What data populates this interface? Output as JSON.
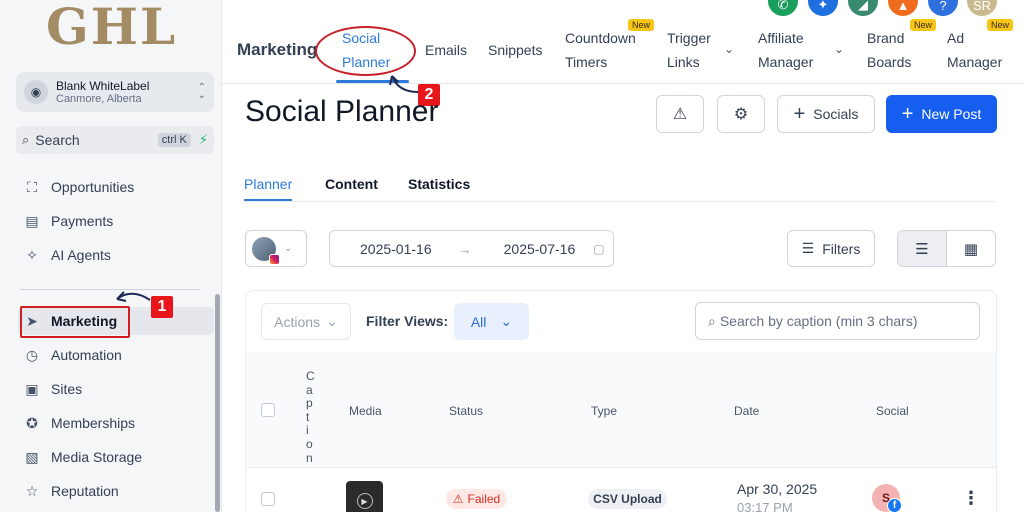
{
  "logo": "GHL",
  "account": {
    "name": "Blank WhiteLabel",
    "location": "Canmore, Alberta"
  },
  "search": {
    "label": "Search",
    "shortcut": "ctrl K"
  },
  "sidebar": {
    "items": [
      {
        "label": "Opportunities",
        "icon": "opportunities-icon",
        "glyph": "⛶"
      },
      {
        "label": "Payments",
        "icon": "payments-icon",
        "glyph": "▤"
      },
      {
        "label": "AI Agents",
        "icon": "ai-agents-icon",
        "glyph": "✧"
      },
      {
        "label": "Marketing",
        "icon": "send-icon",
        "glyph": "➤"
      },
      {
        "label": "Automation",
        "icon": "automation-icon",
        "glyph": "◷"
      },
      {
        "label": "Sites",
        "icon": "sites-icon",
        "glyph": "▣"
      },
      {
        "label": "Memberships",
        "icon": "memberships-icon",
        "glyph": "✪"
      },
      {
        "label": "Media Storage",
        "icon": "media-icon",
        "glyph": "▧"
      },
      {
        "label": "Reputation",
        "icon": "star-icon",
        "glyph": "☆"
      }
    ],
    "active": "Marketing"
  },
  "topnav": {
    "title": "Marketing",
    "tabs": [
      {
        "line1": "Social",
        "line2": "Planner"
      },
      {
        "line1": "Emails",
        "line2": ""
      },
      {
        "line1": "Snippets",
        "line2": ""
      },
      {
        "line1": "Countdown",
        "line2": "Timers"
      },
      {
        "line1": "Trigger",
        "line2": "Links"
      },
      {
        "line1": "Affiliate",
        "line2": "Manager"
      },
      {
        "line1": "Brand",
        "line2": "Boards"
      },
      {
        "line1": "Ad",
        "line2": "Manager"
      }
    ],
    "new_badge": "New",
    "profile_initials": "SR"
  },
  "steps": {
    "one": "1",
    "two": "2"
  },
  "page": {
    "title": "Social Planner",
    "socials_label": "Socials",
    "new_post_label": "New Post",
    "subtabs": [
      "Planner",
      "Content",
      "Statistics"
    ],
    "date_from": "2025-01-16",
    "date_to": "2025-07-16",
    "filters_label": "Filters",
    "actions_label": "Actions",
    "filter_views_label": "Filter Views:",
    "filter_views_value": "All",
    "caption_search_placeholder": "Search by caption (min 3 chars)"
  },
  "table": {
    "headers": {
      "caption": [
        "C",
        "a",
        "p",
        "t",
        "i",
        "o",
        "n"
      ],
      "media": "Media",
      "status": "Status",
      "type": "Type",
      "date": "Date",
      "social": "Social"
    },
    "row": {
      "status": "Failed",
      "type": "CSV Upload",
      "date": "Apr 30, 2025",
      "time": "03:17 PM",
      "avatar": "S",
      "network": "f"
    }
  },
  "colors": {
    "accent": "#2e7ad8",
    "primary_button": "#155eef",
    "annotation_red": "#e8161b",
    "logo_gold": "#a38b63"
  }
}
